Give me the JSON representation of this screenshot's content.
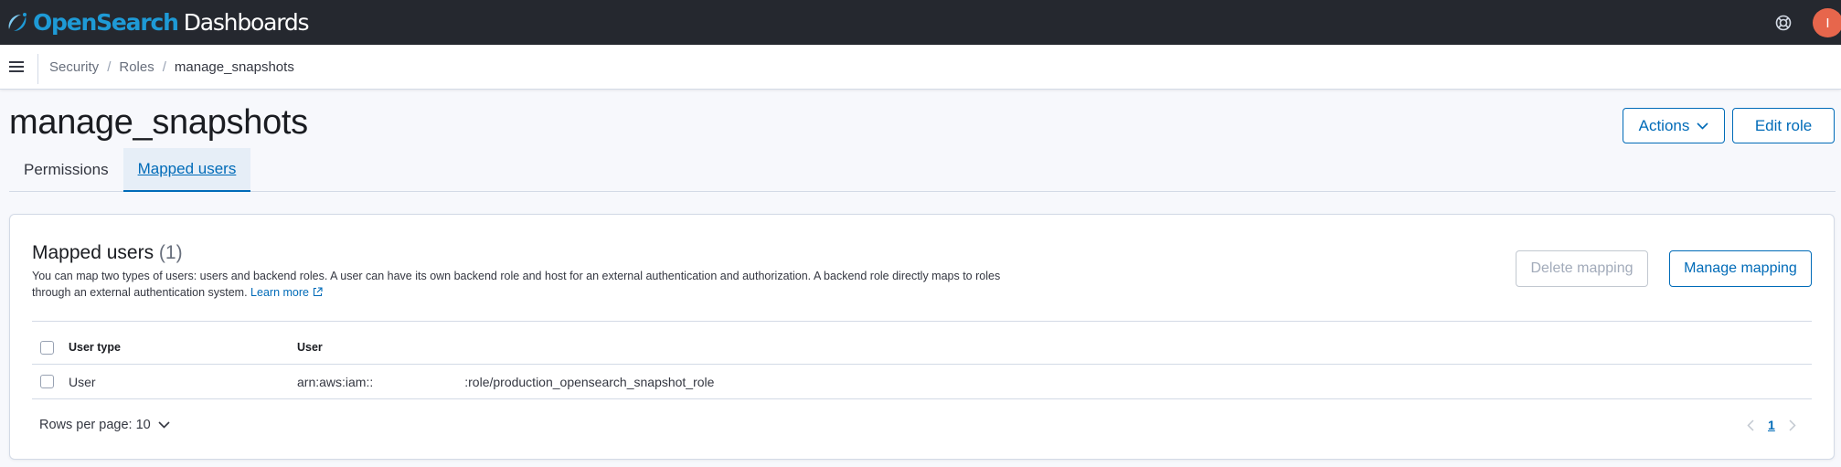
{
  "header": {
    "brand_part1": "OpenSearch",
    "brand_part2": "Dashboards",
    "avatar_initial": "I"
  },
  "breadcrumbs": {
    "items": [
      "Security",
      "Roles"
    ],
    "current": "manage_snapshots"
  },
  "page": {
    "title": "manage_snapshots",
    "actions_label": "Actions",
    "edit_role_label": "Edit role"
  },
  "tabs": [
    {
      "label": "Permissions",
      "selected": false
    },
    {
      "label": "Mapped users",
      "selected": true
    }
  ],
  "panel": {
    "title": "Mapped users",
    "count": "(1)",
    "description": "You can map two types of users: users and backend roles. A user can have its own backend role and host for an external authentication and authorization. A backend role directly maps to roles through an external authentication system.",
    "learn_more": "Learn more",
    "delete_mapping_label": "Delete mapping",
    "manage_mapping_label": "Manage mapping"
  },
  "table": {
    "columns": [
      "User type",
      "User"
    ],
    "rows": [
      {
        "user_type": "User",
        "user_prefix": "arn:aws:iam::",
        "user_suffix": ":role/production_opensearch_snapshot_role"
      }
    ]
  },
  "pagination": {
    "rows_per_page": "Rows per page: 10",
    "current_page": "1"
  },
  "colors": {
    "header_bg": "#25282f",
    "accent": "#006bb8",
    "avatar_bg": "#e7664c"
  }
}
